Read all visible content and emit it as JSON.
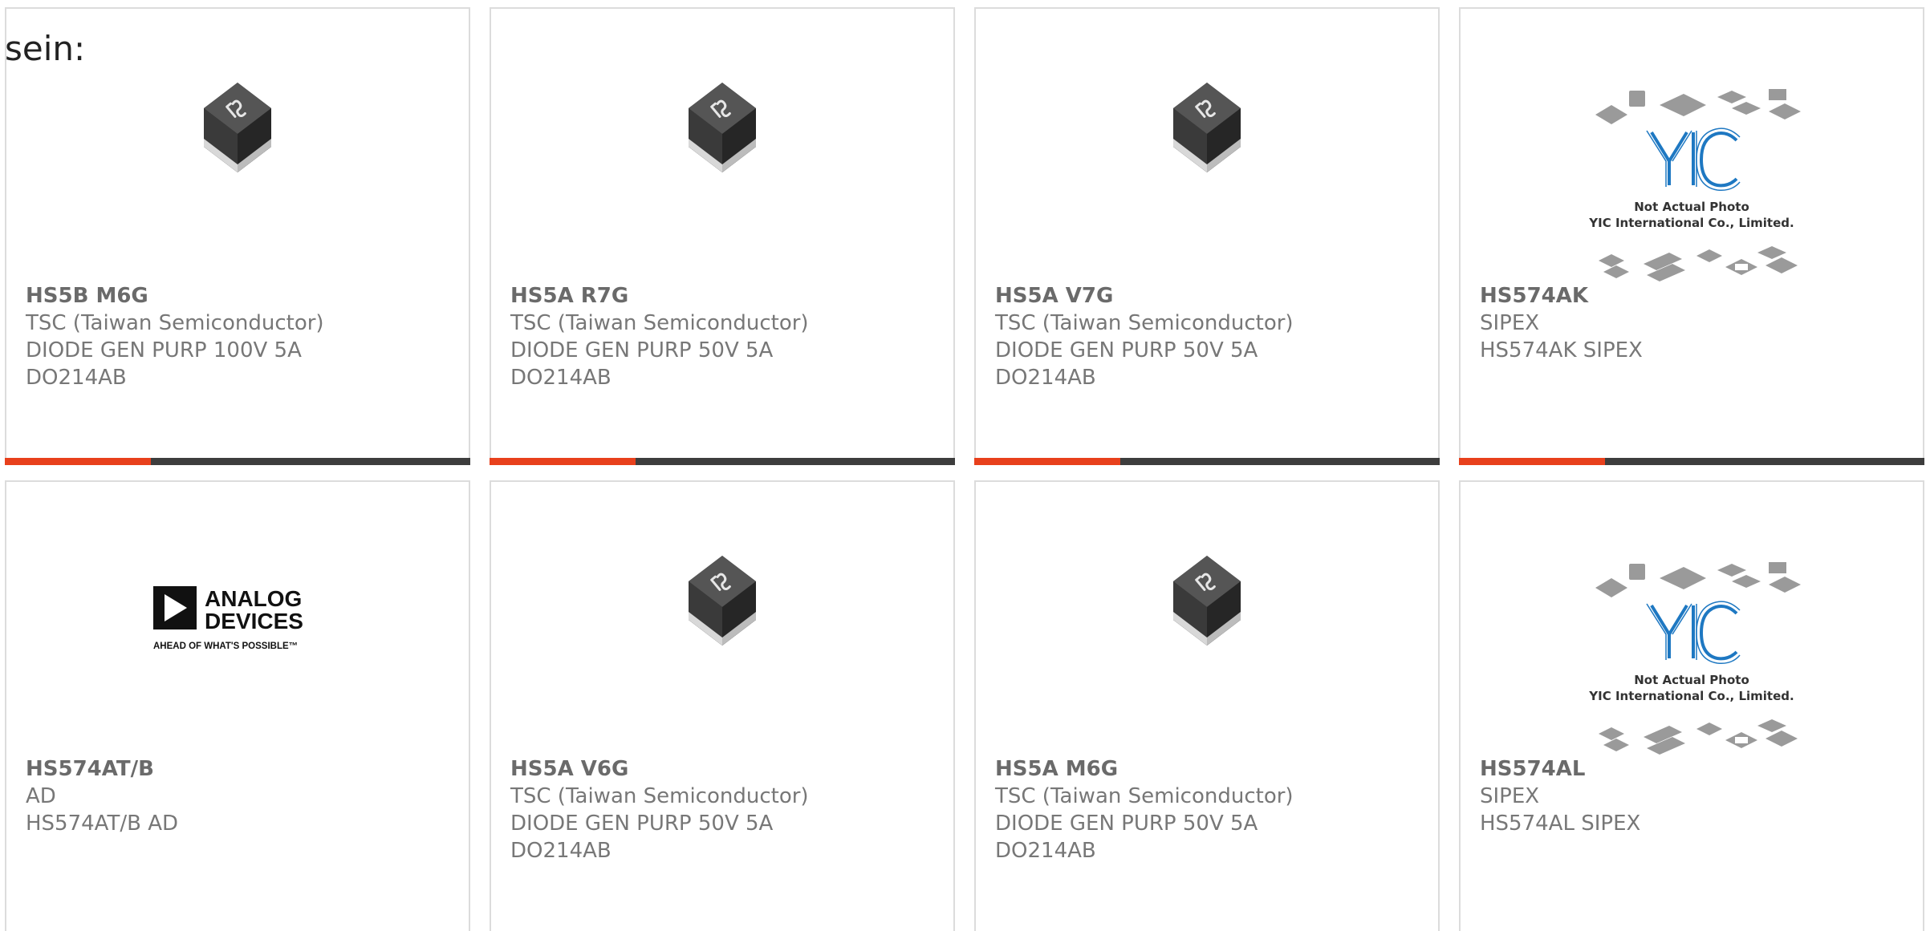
{
  "lead_text": "sein:",
  "colors": {
    "accent": "#e8401c",
    "bar_dark": "#3d3d3d",
    "card_border": "#dcdcdc",
    "text_gray": "#777777"
  },
  "cards": [
    {
      "part_number": "HS5B M6G",
      "manufacturer": "TSC (Taiwan Semiconductor)",
      "description_1": "DIODE GEN PURP 100V 5A",
      "description_2": "DO214AB",
      "image": "diode-chip-icon"
    },
    {
      "part_number": "HS5A R7G",
      "manufacturer": "TSC (Taiwan Semiconductor)",
      "description_1": "DIODE GEN PURP 50V 5A",
      "description_2": "DO214AB",
      "image": "diode-chip-icon"
    },
    {
      "part_number": "HS5A V7G",
      "manufacturer": "TSC (Taiwan Semiconductor)",
      "description_1": "DIODE GEN PURP 50V 5A",
      "description_2": "DO214AB",
      "image": "diode-chip-icon"
    },
    {
      "part_number": "HS574AK",
      "manufacturer": "SIPEX",
      "description_1": "HS574AK SIPEX",
      "description_2": "",
      "image": "yic-placeholder",
      "placeholder_line_1": "Not Actual Photo",
      "placeholder_line_2": "YIC International Co., Limited.",
      "placeholder_logo": "YIC"
    },
    {
      "part_number": "HS574AT/B",
      "manufacturer": "AD",
      "description_1": "HS574AT/B AD",
      "description_2": "",
      "image": "analog-devices-logo",
      "logo_line_1": "ANALOG",
      "logo_line_2": "DEVICES",
      "logo_tagline": "AHEAD OF WHAT'S POSSIBLE™"
    },
    {
      "part_number": "HS5A V6G",
      "manufacturer": "TSC (Taiwan Semiconductor)",
      "description_1": "DIODE GEN PURP 50V 5A",
      "description_2": "DO214AB",
      "image": "diode-chip-icon"
    },
    {
      "part_number": "HS5A M6G",
      "manufacturer": "TSC (Taiwan Semiconductor)",
      "description_1": "DIODE GEN PURP 50V 5A",
      "description_2": "DO214AB",
      "image": "diode-chip-icon"
    },
    {
      "part_number": "HS574AL",
      "manufacturer": "SIPEX",
      "description_1": "HS574AL SIPEX",
      "description_2": "",
      "image": "yic-placeholder",
      "placeholder_line_1": "Not Actual Photo",
      "placeholder_line_2": "YIC International Co., Limited.",
      "placeholder_logo": "YIC"
    }
  ]
}
